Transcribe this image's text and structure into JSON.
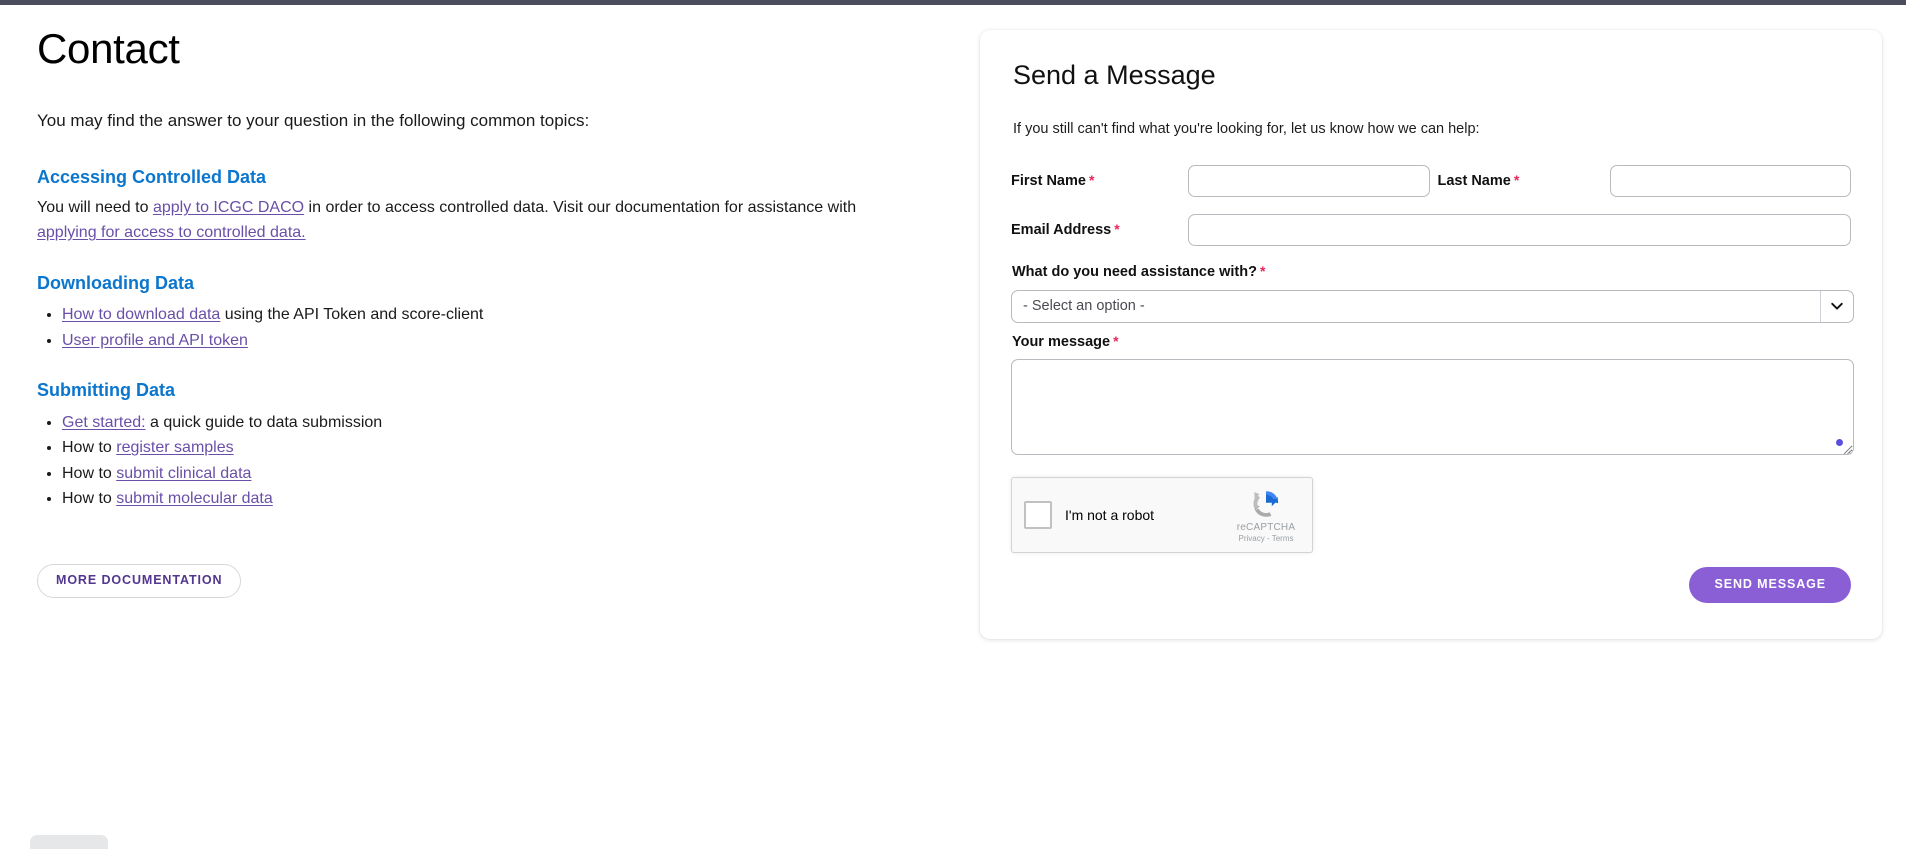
{
  "page": {
    "title": "Contact",
    "intro": "You may find the answer to your question in the following common topics:",
    "more_docs_label": "MORE DOCUMENTATION"
  },
  "topics": {
    "accessing": {
      "heading": "Accessing Controlled Data",
      "para_part1": "You will need to ",
      "link1": "apply to ICGC DACO",
      "para_part2": " in order to access controlled data. Visit our documentation for assistance with ",
      "link2": "applying for access to controlled data."
    },
    "downloading": {
      "heading": "Downloading Data",
      "items": [
        {
          "link": "How to download data",
          "after": " using the API Token and score-client"
        },
        {
          "link": "User profile and API token",
          "after": ""
        }
      ]
    },
    "submitting": {
      "heading": "Submitting Data",
      "items": [
        {
          "before": "",
          "link": "Get started:",
          "after": " a quick guide to data submission"
        },
        {
          "before": "How to ",
          "link": "register samples",
          "after": ""
        },
        {
          "before": "How to ",
          "link": "submit clinical data",
          "after": ""
        },
        {
          "before": "How to ",
          "link": "submit molecular data",
          "after": ""
        }
      ]
    }
  },
  "form": {
    "title": "Send a Message",
    "subtitle": "If you still can't find what you're looking for, let us know how we can help:",
    "required_mark": "*",
    "first_name": {
      "label": "First Name",
      "value": "",
      "placeholder": ""
    },
    "last_name": {
      "label": "Last Name",
      "value": "",
      "placeholder": ""
    },
    "email": {
      "label": "Email Address",
      "value": "",
      "placeholder": ""
    },
    "assistance": {
      "label": "What do you need assistance with?",
      "selected": "- Select an option -",
      "options": [
        "- Select an option -"
      ]
    },
    "message": {
      "label": "Your message",
      "value": "",
      "placeholder": ""
    },
    "recaptcha": {
      "checkbox_label": "I'm not a robot",
      "brand": "reCAPTCHA",
      "legal": "Privacy - Terms"
    },
    "submit_label": "SEND MESSAGE"
  },
  "colors": {
    "heading_blue": "#0b76cd",
    "link_purple": "#6a4fa8",
    "required_red": "#e8265a",
    "accent_purple": "#8a5ed4",
    "button_text_purple": "#52358f",
    "top_strip": "#4a4e5c"
  }
}
